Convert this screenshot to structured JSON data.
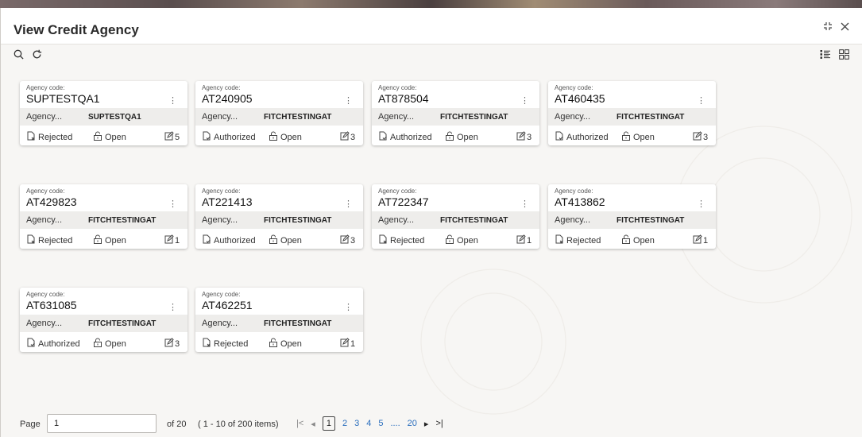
{
  "window": {
    "title": "View Credit Agency"
  },
  "header_icons": [
    "minimize-icon",
    "close-icon"
  ],
  "toolbar": {
    "search_icon": "search-icon",
    "refresh_icon": "refresh-icon"
  },
  "view_icons": [
    "list-view-icon",
    "grid-view-icon"
  ],
  "cards": [
    {
      "code_label": "Agency code:",
      "code": "SUPTESTQA1",
      "agency_label": "Agency...",
      "agency": "SUPTESTQA1",
      "status": "Rejected",
      "lock": "Open",
      "edits": "5"
    },
    {
      "code_label": "Agency code:",
      "code": "AT240905",
      "agency_label": "Agency...",
      "agency": "FITCHTESTINGAT",
      "status": "Authorized",
      "lock": "Open",
      "edits": "3"
    },
    {
      "code_label": "Agency code:",
      "code": "AT878504",
      "agency_label": "Agency...",
      "agency": "FITCHTESTINGAT",
      "status": "Authorized",
      "lock": "Open",
      "edits": "3"
    },
    {
      "code_label": "Agency code:",
      "code": "AT460435",
      "agency_label": "Agency...",
      "agency": "FITCHTESTINGAT",
      "status": "Authorized",
      "lock": "Open",
      "edits": "3"
    },
    {
      "code_label": "Agency code:",
      "code": "AT429823",
      "agency_label": "Agency...",
      "agency": "FITCHTESTINGAT",
      "status": "Rejected",
      "lock": "Open",
      "edits": "1"
    },
    {
      "code_label": "Agency code:",
      "code": "AT221413",
      "agency_label": "Agency...",
      "agency": "FITCHTESTINGAT",
      "status": "Authorized",
      "lock": "Open",
      "edits": "3"
    },
    {
      "code_label": "Agency code:",
      "code": "AT722347",
      "agency_label": "Agency...",
      "agency": "FITCHTESTINGAT",
      "status": "Rejected",
      "lock": "Open",
      "edits": "1"
    },
    {
      "code_label": "Agency code:",
      "code": "AT413862",
      "agency_label": "Agency...",
      "agency": "FITCHTESTINGAT",
      "status": "Rejected",
      "lock": "Open",
      "edits": "1"
    },
    {
      "code_label": "Agency code:",
      "code": "AT631085",
      "agency_label": "Agency...",
      "agency": "FITCHTESTINGAT",
      "status": "Authorized",
      "lock": "Open",
      "edits": "3"
    },
    {
      "code_label": "Agency code:",
      "code": "AT462251",
      "agency_label": "Agency...",
      "agency": "FITCHTESTINGAT",
      "status": "Rejected",
      "lock": "Open",
      "edits": "1"
    }
  ],
  "pager": {
    "page_label": "Page",
    "page_value": "1",
    "of_label": "of 20",
    "items_label": "( 1 - 10 of 200 items)",
    "pages": [
      "1",
      "2",
      "3",
      "4",
      "5",
      "....",
      "20"
    ]
  }
}
